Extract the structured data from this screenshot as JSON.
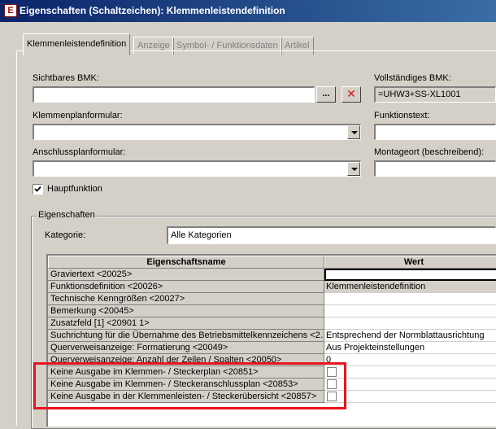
{
  "window": {
    "title": "Eigenschaften (Schaltzeichen): Klemmenleistendefinition"
  },
  "tabs": [
    {
      "label": "Klemmenleistendefinition",
      "active": true
    },
    {
      "label": "Anzeige",
      "active": false
    },
    {
      "label": "Symbol- / Funktionsdaten",
      "active": false
    },
    {
      "label": "Artikel",
      "active": false
    }
  ],
  "form": {
    "sichtbares_bmk": {
      "label": "Sichtbares BMK:",
      "value": ""
    },
    "browse_label": "...",
    "delete_label": "✕",
    "vollstaendiges_bmk": {
      "label": "Vollständiges BMK:",
      "value": "=UHW3+SS-XL1001"
    },
    "klemmenplanformular": {
      "label": "Klemmenplanformular:",
      "value": ""
    },
    "funktionstext": {
      "label": "Funktionstext:",
      "value": ""
    },
    "anschlussplanformular": {
      "label": "Anschlussplanformular:",
      "value": ""
    },
    "montageort": {
      "label": "Montageort (beschreibend):",
      "value": ""
    },
    "hauptfunktion": {
      "label": "Hauptfunktion",
      "checked": true
    }
  },
  "properties": {
    "group_title": "Eigenschaften",
    "kategorie_label": "Kategorie:",
    "kategorie_value": "Alle Kategorien",
    "columns": [
      "Eigenschaftsname",
      "Wert"
    ],
    "rows": [
      {
        "name": "Graviertext <20025>",
        "value": ""
      },
      {
        "name": "Funktionsdefinition <20026>",
        "value": "Klemmenleistendefinition"
      },
      {
        "name": "Technische Kenngrößen <20027>",
        "value": ""
      },
      {
        "name": "Bemerkung <20045>",
        "value": ""
      },
      {
        "name": "Zusatzfeld [1] <20901 1>",
        "value": ""
      },
      {
        "name": "Suchrichtung für die Übernahme des Betriebsmittelkennzeichens <2…",
        "value": "Entsprechend der Normblattausrichtung"
      },
      {
        "name": "Querverweisanzeige: Formatierung <20049>",
        "value": "Aus Projekteinstellungen"
      },
      {
        "name": "Querverweisanzeige: Anzahl der Zeilen / Spalten <20050>",
        "value": "0"
      },
      {
        "name": "Keine Ausgabe im Klemmen- / Steckerplan <20851>",
        "value": "",
        "checkbox": true
      },
      {
        "name": "Keine Ausgabe im Klemmen- / Steckeranschlussplan <20853>",
        "value": "",
        "checkbox": true
      },
      {
        "name": "Keine Ausgabe in der Klemmenleisten- / Steckerübersicht <20857>",
        "value": "",
        "checkbox": true
      }
    ]
  },
  "colors": {
    "highlight": "#e8141e",
    "titlebar": "#0a246a"
  }
}
